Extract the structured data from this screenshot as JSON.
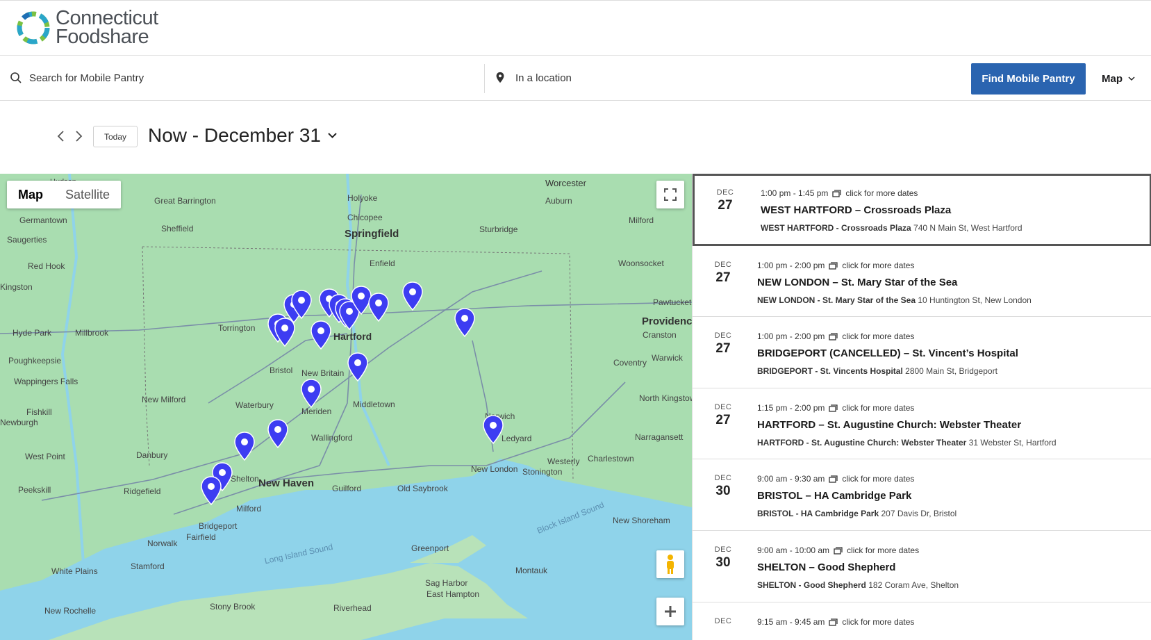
{
  "brand": {
    "line1": "Connecticut",
    "line2": "Foodshare"
  },
  "search": {
    "query_placeholder": "Search for Mobile Pantry",
    "location_placeholder": "In a location",
    "find_button": "Find Mobile Pantry",
    "view_mode": "Map"
  },
  "datenav": {
    "today": "Today",
    "range": "Now - December 31"
  },
  "map": {
    "toggle_map": "Map",
    "toggle_satellite": "Satellite",
    "labels": [
      "Worcester",
      "Hudson",
      "Holyoke",
      "Great Barrington",
      "Auburn",
      "Chicopee",
      "Springfield",
      "Sturbridge",
      "Milford",
      "Sheffield",
      "Germantown",
      "Saugerties",
      "Enfield",
      "Woonsocket",
      "Red Hook",
      "Kingston",
      "Pawtucket",
      "Providence",
      "Cranston",
      "Hyde Park",
      "Millbrook",
      "Torrington",
      "Hartford",
      "Bristol",
      "New Britain",
      "Poughkeepsie",
      "Coventry",
      "Warwick",
      "Wappingers Falls",
      "New Milford",
      "Waterbury",
      "Middletown",
      "North Kingstown",
      "Fishkill",
      "Newburgh",
      "Meriden",
      "Wallingford",
      "Norwich",
      "Ledyard",
      "Narragansett",
      "Danbury",
      "West Point",
      "Shelton",
      "New Haven",
      "New London",
      "Stonington",
      "Westerly",
      "Charlestown",
      "Peekskill",
      "Ridgefield",
      "Guilford",
      "Old Saybrook",
      "Milford",
      "Bridgeport",
      "Fairfield",
      "Norwalk",
      "Block Island Sound",
      "New Shoreham",
      "Long Island Sound",
      "Greenport",
      "Stamford",
      "White Plains",
      "Montauk",
      "Sag Harbor",
      "East Hampton",
      "Stony Brook",
      "Riverhead",
      "New Rochelle"
    ]
  },
  "events": [
    {
      "month": "DEC",
      "day": "27",
      "time": "1:00 pm - 1:45 pm",
      "more": "click for more dates",
      "title": "WEST HARTFORD – Crossroads Plaza",
      "loc_name": "WEST HARTFORD - Crossroads Plaza",
      "address": "740 N Main St, West Hartford"
    },
    {
      "month": "DEC",
      "day": "27",
      "time": "1:00 pm - 2:00 pm",
      "more": "click for more dates",
      "title": "NEW LONDON – St. Mary Star of the Sea",
      "loc_name": "NEW LONDON - St. Mary Star of the Sea",
      "address": "10 Huntington St, New London"
    },
    {
      "month": "DEC",
      "day": "27",
      "time": "1:00 pm - 2:00 pm",
      "more": "click for more dates",
      "title": "BRIDGEPORT (CANCELLED) – St. Vincent’s Hospital",
      "loc_name": "BRIDGEPORT - St. Vincents Hospital",
      "address": "2800 Main St, Bridgeport"
    },
    {
      "month": "DEC",
      "day": "27",
      "time": "1:15 pm - 2:00 pm",
      "more": "click for more dates",
      "title": "HARTFORD – St. Augustine Church: Webster Theater",
      "loc_name": "HARTFORD - St. Augustine Church: Webster Theater",
      "address": "31 Webster St, Hartford"
    },
    {
      "month": "DEC",
      "day": "30",
      "time": "9:00 am - 9:30 am",
      "more": "click for more dates",
      "title": "BRISTOL – HA Cambridge Park",
      "loc_name": "BRISTOL - HA Cambridge Park",
      "address": "207 Davis Dr, Bristol"
    },
    {
      "month": "DEC",
      "day": "30",
      "time": "9:00 am - 10:00 am",
      "more": "click for more dates",
      "title": "SHELTON – Good Shepherd",
      "loc_name": "SHELTON - Good Shepherd",
      "address": "182 Coram Ave, Shelton"
    },
    {
      "month": "DEC",
      "day": "",
      "time": "9:15 am - 9:45 am",
      "more": "click for more dates",
      "title": "",
      "loc_name": "",
      "address": ""
    }
  ],
  "colors": {
    "accent": "#2a64b0",
    "pin": "#3d3df2",
    "water": "#8fd3ea",
    "land": "#a9ddb0"
  }
}
